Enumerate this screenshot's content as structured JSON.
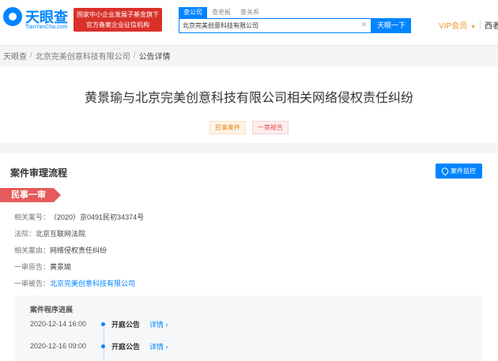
{
  "header": {
    "logo_cn": "天眼查",
    "logo_en": "TianYanCha.com",
    "gov_badge_line1": "国家中小企业发展子基金旗下",
    "gov_badge_line2": "官方备案企业征信机构",
    "search_tabs": [
      "查公司",
      "查老板",
      "查关系"
    ],
    "search_value": "北京完美创意科技有限公司",
    "search_button": "天眼一下",
    "vip_label": "VIP会员",
    "user_label": "西者"
  },
  "breadcrumb": [
    "天眼查",
    "北京完美创意科技有限公司",
    "公告详情"
  ],
  "case": {
    "title": "黄景瑜与北京完美创意科技有限公司相关网络侵权责任纠纷",
    "tags": [
      "民事案件",
      "一审被告"
    ]
  },
  "process": {
    "title": "案件审理流程",
    "monitor_button": "案件监控",
    "stage": "民事一审",
    "info": [
      {
        "label": "相关案号：",
        "value": "（2020）京0491民初34374号"
      },
      {
        "label": "法院：",
        "value": "北京互联网法院"
      },
      {
        "label": "相关案由：",
        "value": "网络侵权责任纠纷"
      },
      {
        "label": "一审原告：",
        "value": "黄景瑜"
      },
      {
        "label": "一审被告：",
        "value": "北京完美创意科技有限公司"
      }
    ],
    "progress_title": "案件程序进展",
    "timeline": [
      {
        "date": "2020-12-14 16:00",
        "event": "开庭公告",
        "link": "详情 ›"
      },
      {
        "date": "2020-12-16 09:00",
        "event": "开庭公告",
        "link": "详情 ›"
      }
    ]
  },
  "colors": {
    "brand": "#0084ff",
    "vip": "#f09a2a",
    "stage": "#e55a5a",
    "gov_badge": "#d9312a"
  }
}
